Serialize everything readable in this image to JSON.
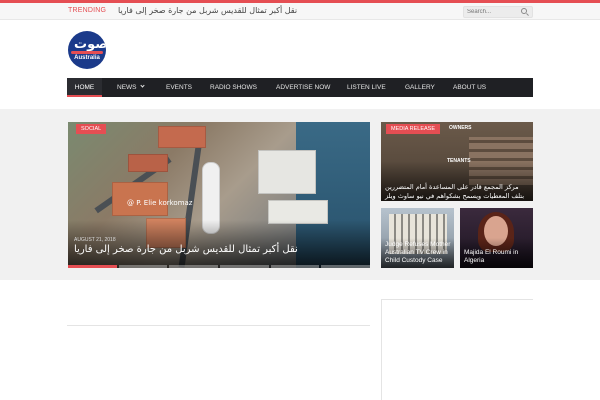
{
  "topbar": {
    "trending_label": "TRENDING",
    "trending_headline": "نقل أكبر تمثال للقديس شربل من جارة صخر إلى فاريا",
    "search_placeholder": "Search..."
  },
  "logo": {
    "arabic_text": "صوت",
    "english_text": "Australia"
  },
  "nav": {
    "items": [
      {
        "label": "HOME",
        "active": true
      },
      {
        "label": "NEWS",
        "has_dropdown": true
      },
      {
        "label": "EVENTS"
      },
      {
        "label": "RADIO SHOWS"
      },
      {
        "label": "ADVERTISE NOW"
      },
      {
        "label": "LISTEN LIVE"
      },
      {
        "label": "GALLERY"
      },
      {
        "label": "ABOUT US"
      }
    ]
  },
  "featured": {
    "category": "SOCIAL",
    "watermark": "@ P. Elie korkomaz",
    "meta": "AUGUST 21, 2018",
    "title": "نقل أكبر تمثال للقديس شربل من جارة صخر إلى فاريا"
  },
  "side_top": {
    "category": "MEDIA RELEASE",
    "sign_top": "OWNERS",
    "sign_mid": "TENANTS",
    "title": "مركز المجمع قادر على المساعدة أمام المتضررين بتلف المعطيات ويسمح بشكواهم في نيو ساوث ويلز"
  },
  "card_a": {
    "title": "Judge Refuses Mother Australian TV Crew in Child Custody Case"
  },
  "card_b": {
    "title": "Majida El Roumi in Algeria"
  },
  "colors": {
    "accent": "#e54e53",
    "nav_bg": "#1f2024",
    "band_bg": "#f1f1f1"
  }
}
